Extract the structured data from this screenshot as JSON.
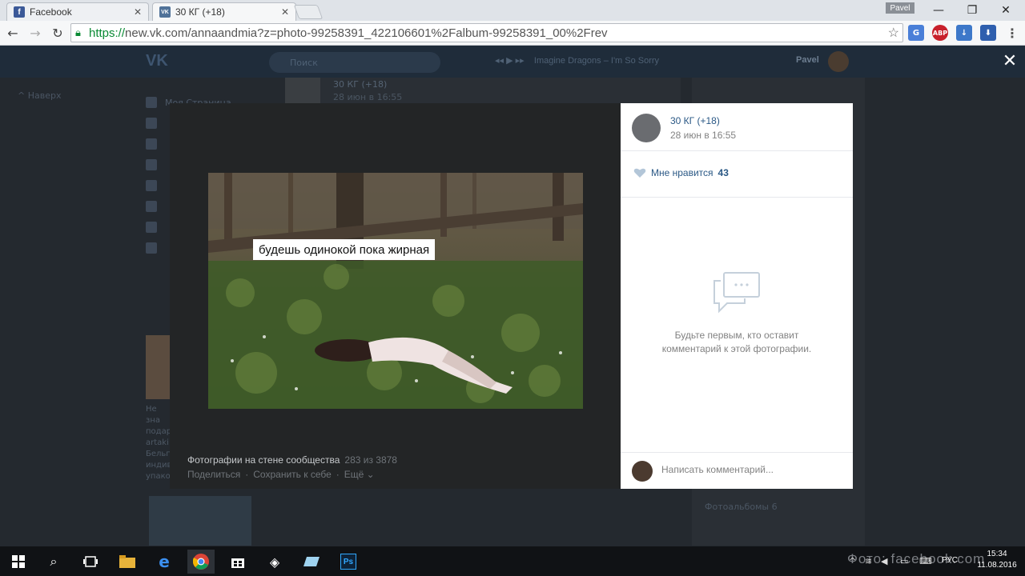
{
  "browser": {
    "tabs": [
      {
        "title": "Facebook",
        "favicon": "f",
        "favicon_color": "#3b5998",
        "active": false
      },
      {
        "title": "30 КГ (+18)",
        "favicon": "VK",
        "favicon_color": "#507299",
        "active": true
      }
    ],
    "profile_name": "Pavel",
    "url_scheme": "https://",
    "url_rest": "new.vk.com/annaandmia?z=photo-99258391_422106601%2Falbum-99258391_00%2Frev"
  },
  "vk_bg": {
    "search_placeholder": "Поиск",
    "now_playing": "Imagine Dragons – I'm So Sorry",
    "user_name": "Pavel",
    "back_label": "Наверх",
    "menu_first": "Моя Страница",
    "post_name": "30 КГ (+18)",
    "post_date": "28 июн в 16:55",
    "ad_lines": [
      "Не зна",
      "подар",
      "artaki",
      "Бельг",
      "индив",
      "упако"
    ],
    "albums_label": "Фотоальбомы",
    "albums_count": "6"
  },
  "viewer": {
    "caption": "будешь одинокой пока жирная",
    "album_label": "Фотографии на стене сообщества",
    "position": "283 из 3878",
    "actions": [
      "Поделиться",
      "Сохранить к себе",
      "Ещё"
    ]
  },
  "panel": {
    "group_name": "30 КГ (+18)",
    "post_date": "28 июн в 16:55",
    "like_label": "Мне нравится",
    "like_count": "43",
    "empty_line1": "Будьте первым, кто оставит",
    "empty_line2": "комментарий к этой фотографии.",
    "comment_placeholder": "Написать комментарий..."
  },
  "taskbar": {
    "lang": "РУС",
    "time": "15:34",
    "date": "11.08.2016",
    "watermark": "Фото: facebook.com"
  },
  "colors": {
    "vk_link": "#2a5885",
    "muted": "#828282",
    "https_green": "#0a8a34"
  }
}
